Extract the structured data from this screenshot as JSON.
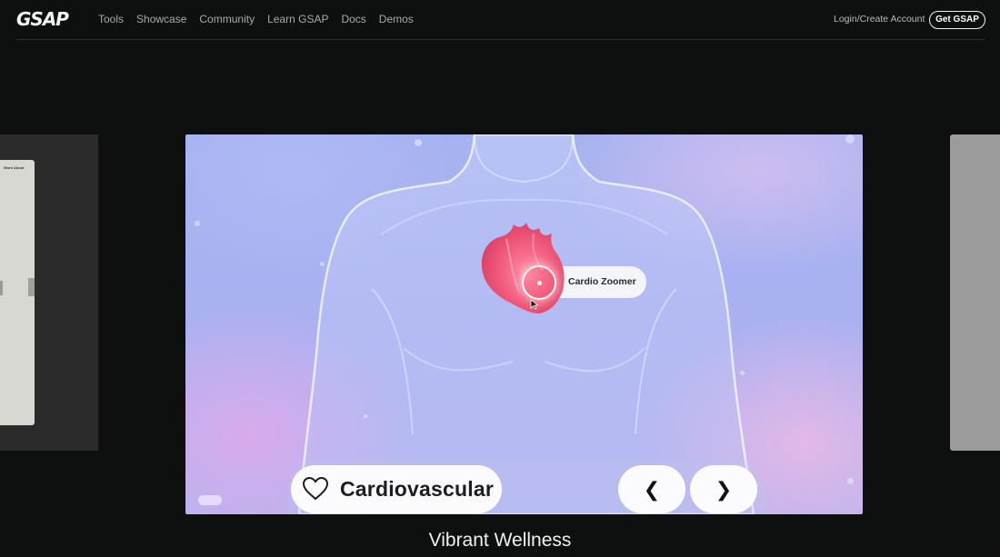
{
  "nav": {
    "logo": "GSAP",
    "links": [
      "Tools",
      "Showcase",
      "Community",
      "Learn GSAP",
      "Docs",
      "Demos"
    ],
    "login_label": "Login/Create Account",
    "cta_label": "Get GSAP"
  },
  "slide": {
    "hotspot_label": "Cardio Zoomer",
    "category_label": "Cardiovascular",
    "prev_label": "❮",
    "next_label": "❯",
    "icons": [
      "heart-outline-icon",
      "chevron-left-icon",
      "chevron-right-icon",
      "cursor-icon"
    ],
    "colors": {
      "heart": "#f0587a",
      "background": "#a9b1f1"
    }
  },
  "side_left": {
    "nav_text": "Work    About"
  },
  "showcase_title": "Vibrant Wellness"
}
